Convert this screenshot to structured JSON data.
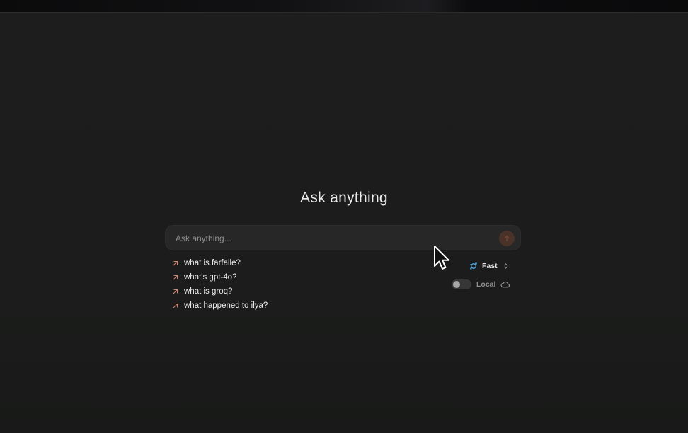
{
  "hero": {
    "title": "Ask anything"
  },
  "search": {
    "placeholder": "Ask anything...",
    "value": ""
  },
  "suggestions": [
    {
      "text": "what is farfalle?"
    },
    {
      "text": "what's gpt-4o?"
    },
    {
      "text": "what is groq?"
    },
    {
      "text": "what happened to ilya?"
    }
  ],
  "model": {
    "label": "Fast",
    "icon": "sparkle-icon"
  },
  "local_toggle": {
    "label": "Local",
    "on": false,
    "icon": "cloud-icon"
  },
  "colors": {
    "background": "#1b1c1b",
    "accent": "#d2806a",
    "model_icon": "#4fa3d9"
  }
}
